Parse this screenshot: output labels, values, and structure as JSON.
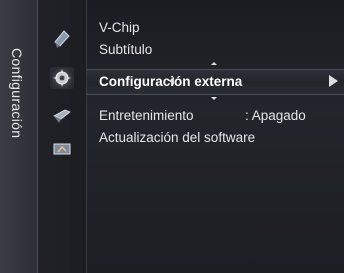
{
  "tab": {
    "label": "Configuración"
  },
  "icons": [
    {
      "name": "picture-icon"
    },
    {
      "name": "setup-gear-icon"
    },
    {
      "name": "input-icon"
    },
    {
      "name": "application-icon"
    }
  ],
  "menu": {
    "items": [
      {
        "label": "V-Chip"
      },
      {
        "label": "Subtítulo"
      },
      {
        "label": "Configuración externa",
        "selected": true
      },
      {
        "label": "Entretenimiento",
        "value": ": Apagado"
      },
      {
        "label": "Actualización del software"
      }
    ]
  },
  "colors": {
    "highlight_text": "#ffffff",
    "text": "#e6e6e6",
    "background": "#1e2025"
  }
}
